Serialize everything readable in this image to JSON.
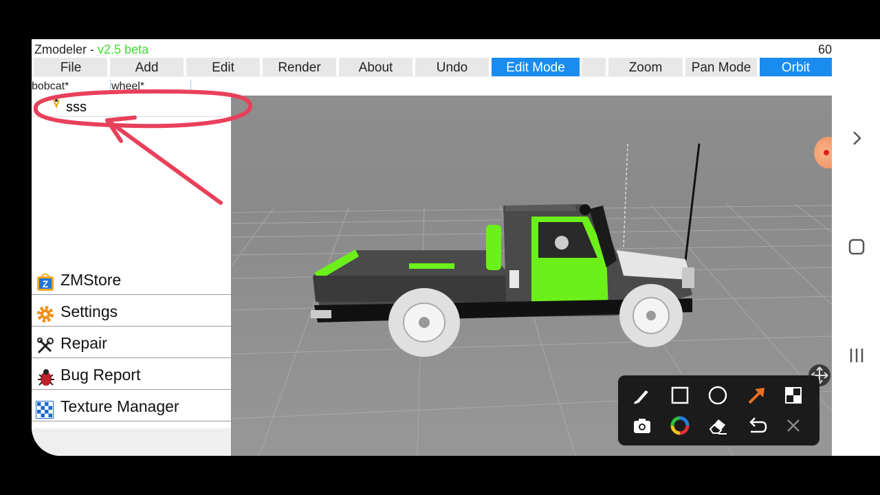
{
  "app": {
    "name": "Zmodeler - ",
    "version": "v2.5 beta",
    "fps": "60"
  },
  "menu": {
    "file": "File",
    "add": "Add",
    "edit": "Edit",
    "render": "Render",
    "about": "About",
    "undo": "Undo",
    "edit_mode": "Edit Mode",
    "zoom": "Zoom",
    "pan_mode": "Pan Mode",
    "orbit": "Orbit"
  },
  "tabs": [
    "bobcat*",
    "wheel*"
  ],
  "tree": {
    "selected_item": "sss"
  },
  "side_menu": {
    "zmstore": "ZMStore",
    "settings": "Settings",
    "repair": "Repair",
    "bug_report": "Bug Report",
    "texture_manager": "Texture Manager"
  },
  "draw_tools": [
    "brush",
    "rectangle",
    "circle",
    "arrow",
    "mosaic",
    "camera",
    "color-wheel",
    "eraser",
    "undo",
    "close"
  ],
  "colors": {
    "accent_active": "#1a8cf0",
    "version_green": "#3bdc2c",
    "annotation": "#e8405a",
    "model_green": "#6cf01a",
    "arrow_tool": "#f07020"
  }
}
